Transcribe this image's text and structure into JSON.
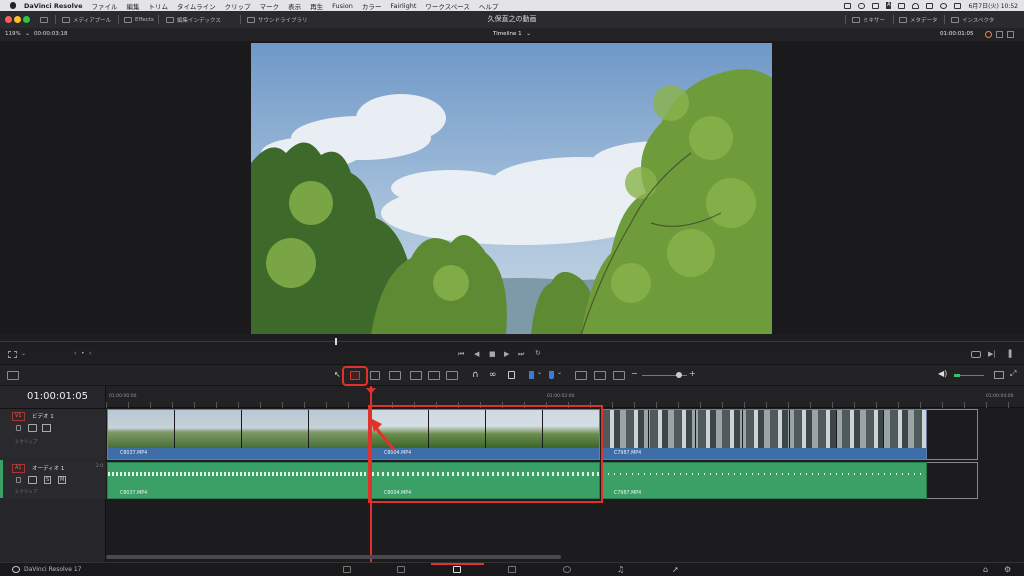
{
  "menubar": {
    "app_name": "DaVinci Resolve",
    "items": [
      "ファイル",
      "編集",
      "トリム",
      "タイムライン",
      "クリップ",
      "マーク",
      "表示",
      "再生",
      "Fusion",
      "カラー",
      "Fairlight",
      "ワークスペース",
      "ヘルプ"
    ],
    "date_time": "6月7日(火) 10:52",
    "input_badge": "A"
  },
  "titlebar": {
    "media_pool": "メディアプール",
    "effects": "Effects",
    "edit_index": "編集インデックス",
    "sound_library": "サウンドライブラリ",
    "project_title": "久保直之の動画",
    "mixer": "ミキサー",
    "metadata": "メタデータ",
    "inspector": "インスペクタ"
  },
  "viewer": {
    "zoom": "119%",
    "source_tc": "00:00:03:18",
    "timeline_name": "Timeline 1",
    "record_tc": "01:00:01:05"
  },
  "timeline": {
    "current_tc": "01:00:01:05",
    "ruler": [
      "01:00:00:00",
      "01:00:02:00",
      "01:00:04:00"
    ],
    "tracks": [
      {
        "id": "V1",
        "name": "ビデオ 1",
        "clip_count": "3 クリップ"
      },
      {
        "id": "A1",
        "name": "オーディオ 1",
        "clip_count": "3 クリップ",
        "channel": "2.0"
      }
    ],
    "clips": {
      "v1": [
        "C8037.MP4",
        "C8004.MP4",
        "C7987.MP4"
      ],
      "a1": [
        "C8037.MP4",
        "C8004.MP4",
        "C7987.MP4"
      ]
    },
    "audio_button_s": "S",
    "audio_button_m": "M"
  },
  "colors": {
    "accent_red": "#e0322a",
    "video_label": "#3d6ea8",
    "audio_clip": "#3aa066"
  },
  "footer": {
    "app_version": "DaVinci Resolve 17"
  }
}
